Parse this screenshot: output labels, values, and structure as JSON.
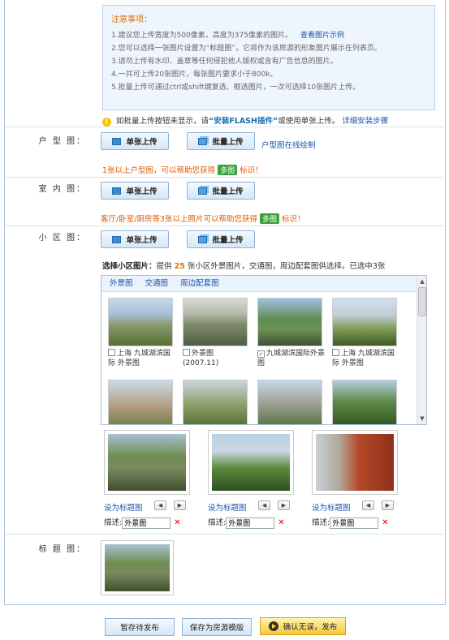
{
  "notice": {
    "title": "注意事项：",
    "items": [
      "1.建议您上传宽度为500像素，高度为375像素的图片。",
      "2.您可以选择一张图片设置为“标题图”，它将作为该房源的形象图片展示在列表页。",
      "3.请勿上传有水印、盖章等任何侵犯他人版权或含有广告信息的图片。",
      "4.一共可上传20张图片，每张图片要求小于800k。",
      "5.批量上传可通过ctrl或shift键复选、框选图片，一次可选择10张图片上传。"
    ],
    "example_link": "查看图片示例"
  },
  "tip": {
    "prefix": "如批量上传按钮未显示，请",
    "install": "“安装FLASH插件”",
    "middle": "或使用单张上传。",
    "steps_link": "详细安装步骤"
  },
  "sections": {
    "huxing": {
      "label": "户 型 图：",
      "single": "单张上传",
      "batch": "批量上传",
      "online_link": "户型图在线绘制",
      "hint_pre": "1张以上户型图，可以帮助您获得",
      "badge": "多图",
      "hint_post": "标识！"
    },
    "shinei": {
      "label": "室 内 图：",
      "single": "单张上传",
      "batch": "批量上传",
      "hint_pre": "客厅/卧室/厨房等3张以上照片可以帮助您获得",
      "badge": "多图",
      "hint_post": "标识！"
    },
    "xiaoqu": {
      "label": "小 区 图：",
      "single": "单张上传",
      "batch": "批量上传"
    }
  },
  "select": {
    "title": "选择小区图片：",
    "pre": "提供",
    "count": "25",
    "post": "张小区外景图片，交通图，周边配套图供选择。已选中3张"
  },
  "gallery_tabs": [
    "外景图",
    "交通图",
    "周边配套图"
  ],
  "gallery_items": [
    {
      "checked": false,
      "caption": "上海 九城湖滨国际 外景图"
    },
    {
      "checked": false,
      "caption": "外景图 (2007.11)"
    },
    {
      "checked": true,
      "caption": "九城湖滨国际外景图"
    },
    {
      "checked": false,
      "caption": "上海 九城湖滨国际 外景图"
    }
  ],
  "selected": [
    {
      "set_title": "设为标题图",
      "desc_label": "描述:",
      "desc_value": "外景图"
    },
    {
      "set_title": "设为标题图",
      "desc_label": "描述:",
      "desc_value": "外景图"
    },
    {
      "set_title": "设为标题图",
      "desc_label": "描述:",
      "desc_value": "外景图"
    }
  ],
  "title_image_label": "标 题 图：",
  "buttons": {
    "draft": "暂存待发布",
    "template": "保存为房源模版",
    "publish": "确认无误，发布"
  }
}
